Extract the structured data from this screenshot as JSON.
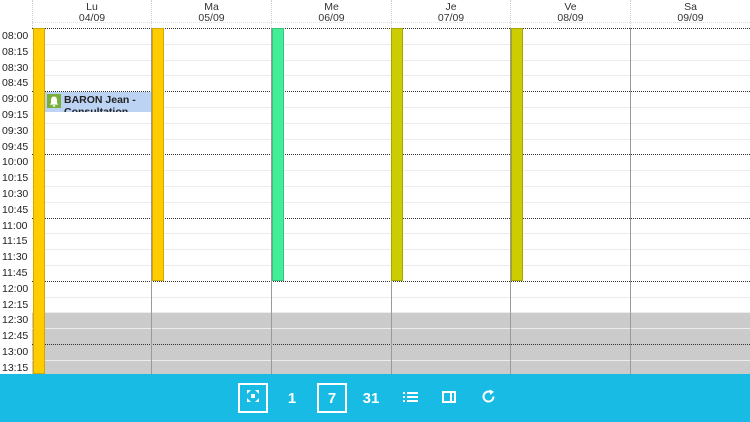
{
  "days": [
    {
      "name": "Lu",
      "date": "04/09"
    },
    {
      "name": "Ma",
      "date": "05/09"
    },
    {
      "name": "Me",
      "date": "06/09"
    },
    {
      "name": "Je",
      "date": "07/09"
    },
    {
      "name": "Ve",
      "date": "08/09"
    },
    {
      "name": "Sa",
      "date": "09/09"
    }
  ],
  "times": [
    "08:00",
    "08:15",
    "08:30",
    "08:45",
    "09:00",
    "09:15",
    "09:30",
    "09:45",
    "10:00",
    "10:15",
    "10:30",
    "10:45",
    "11:00",
    "11:15",
    "11:30",
    "11:45",
    "12:00",
    "12:15",
    "12:30",
    "12:45",
    "13:00",
    "13:15"
  ],
  "availability_colors": [
    "#ffcc00",
    "#ffcc00",
    "#44ee99",
    "#cccc00",
    "#cccc00"
  ],
  "event": {
    "title": "BARON Jean - Consultation",
    "icon": "bell-icon",
    "color": "#bcd3f3",
    "icon_color": "#7ab03a"
  },
  "toolbar": {
    "day_label": "1",
    "week_label": "7",
    "month_label": "31",
    "fit_icon": "fit-screen-icon",
    "list_icon": "list-icon",
    "panel_icon": "panel-icon",
    "refresh_icon": "refresh-icon",
    "selected": "week",
    "bg_color": "#17bbe3"
  }
}
